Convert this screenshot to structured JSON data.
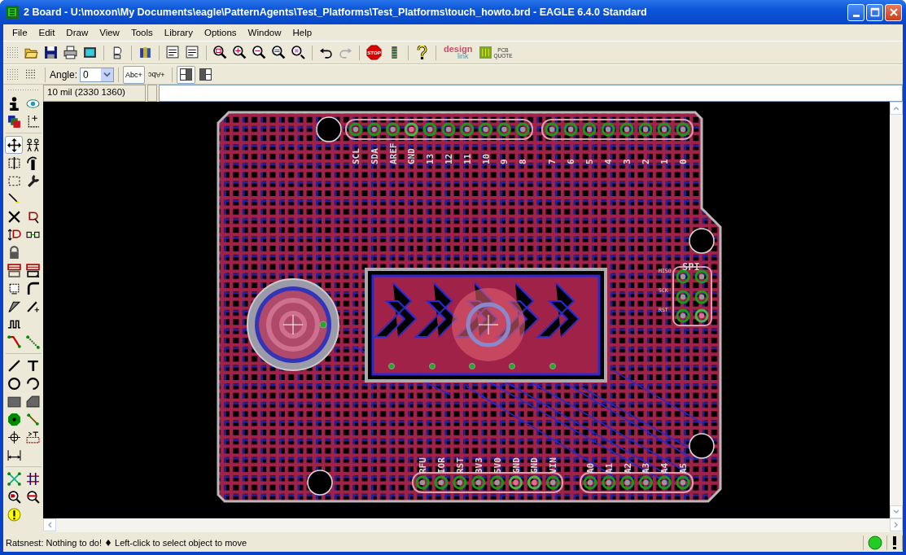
{
  "window": {
    "title": "2 Board - U:\\moxon\\My Documents\\eagle\\PatternAgents\\Test_Platforms\\Test_Platforms\\touch_howto.brd - EAGLE 6.4.0 Standard"
  },
  "menu": [
    "File",
    "Edit",
    "Draw",
    "View",
    "Tools",
    "Library",
    "Options",
    "Window",
    "Help"
  ],
  "toolbar": {
    "stop_label": "STOP",
    "design_logo": [
      "design",
      "link"
    ],
    "quote_logo": [
      "PCB",
      "QUOTE"
    ]
  },
  "param_bar": {
    "angle_label": "Angle:",
    "angle_value": "0",
    "text_buttons": [
      {
        "label": "Abc",
        "plus": "+",
        "kind": "normal",
        "pressed": true
      },
      {
        "label": "Abc",
        "plus": "+",
        "kind": "mirrored",
        "pressed": false
      }
    ],
    "layout_buttons": [
      {
        "pressed": true
      },
      {
        "pressed": false
      }
    ]
  },
  "coord_bar": {
    "coordinates": "10 mil (2330 1360)"
  },
  "tools": [
    {
      "selected": false
    },
    {
      "selected": false
    },
    {
      "selected": false
    },
    {
      "selected": false
    },
    {
      "selected": true
    },
    {
      "selected": false
    },
    {
      "selected": false
    },
    {
      "selected": false
    },
    {
      "selected": false
    },
    {
      "selected": false
    },
    {
      "selected": false
    },
    {
      "selected": false
    },
    {
      "selected": false
    },
    {
      "selected": false
    },
    {
      "selected": false
    },
    {
      "selected": false
    },
    {
      "selected": false
    },
    {
      "selected": false
    },
    {
      "selected": false
    },
    {
      "selected": false
    },
    {
      "selected": false
    },
    {
      "selected": false
    },
    {
      "selected": false
    },
    {
      "selected": false
    },
    {
      "selected": false
    },
    {
      "selected": false
    },
    {
      "selected": false
    },
    {
      "selected": false
    },
    {
      "selected": false
    },
    {
      "selected": false
    },
    {
      "selected": false
    },
    {
      "selected": false
    },
    {
      "selected": false
    },
    {
      "selected": false
    },
    {
      "selected": false
    },
    {
      "selected": false
    },
    {
      "selected": false
    },
    {
      "selected": false
    },
    {
      "selected": false
    },
    {
      "selected": false
    },
    {
      "selected": false
    }
  ],
  "board": {
    "top_header": [
      {
        "label": "SCL",
        "highlighted": false
      },
      {
        "label": "SDA",
        "highlighted": false
      },
      {
        "label": "AREF",
        "highlighted": false
      },
      {
        "label": "GND",
        "highlighted": true
      },
      {
        "label": "13",
        "highlighted": false
      },
      {
        "label": "12",
        "highlighted": false
      },
      {
        "label": "11",
        "highlighted": false
      },
      {
        "label": "10",
        "highlighted": false
      },
      {
        "label": "9",
        "highlighted": false
      },
      {
        "label": "8",
        "highlighted": false
      },
      {
        "label": "7",
        "highlighted": false
      },
      {
        "label": "6",
        "highlighted": false
      },
      {
        "label": "5",
        "highlighted": false
      },
      {
        "label": "4",
        "highlighted": false
      },
      {
        "label": "3",
        "highlighted": false
      },
      {
        "label": "2",
        "highlighted": false
      },
      {
        "label": "1",
        "highlighted": false
      },
      {
        "label": "0",
        "highlighted": false
      }
    ],
    "bottom_header": [
      {
        "label": "RFU",
        "highlighted": false
      },
      {
        "label": "IOR",
        "highlighted": false
      },
      {
        "label": "RST",
        "highlighted": false
      },
      {
        "label": "3V3",
        "highlighted": false
      },
      {
        "label": "5V0",
        "highlighted": false
      },
      {
        "label": "GND",
        "highlighted": true
      },
      {
        "label": "GND",
        "highlighted": true
      },
      {
        "label": "VIN",
        "highlighted": false
      },
      {
        "label": "A0",
        "highlighted": false
      },
      {
        "label": "A1",
        "highlighted": false
      },
      {
        "label": "A2",
        "highlighted": false
      },
      {
        "label": "A3",
        "highlighted": false
      },
      {
        "label": "A4",
        "highlighted": false
      },
      {
        "label": "A5",
        "highlighted": false
      }
    ],
    "spi": {
      "title": "SPI",
      "labels": [
        "MISO",
        "SCK",
        "RST"
      ],
      "pads": [
        {
          "highlighted": false
        },
        {
          "highlighted": false
        },
        {
          "highlighted": false
        },
        {
          "highlighted": false
        },
        {
          "highlighted": false
        },
        {
          "highlighted": true
        }
      ]
    }
  },
  "status_bar": {
    "message": "Ratsnest: Nothing to do!",
    "hint": "Left-click to select object to move"
  }
}
